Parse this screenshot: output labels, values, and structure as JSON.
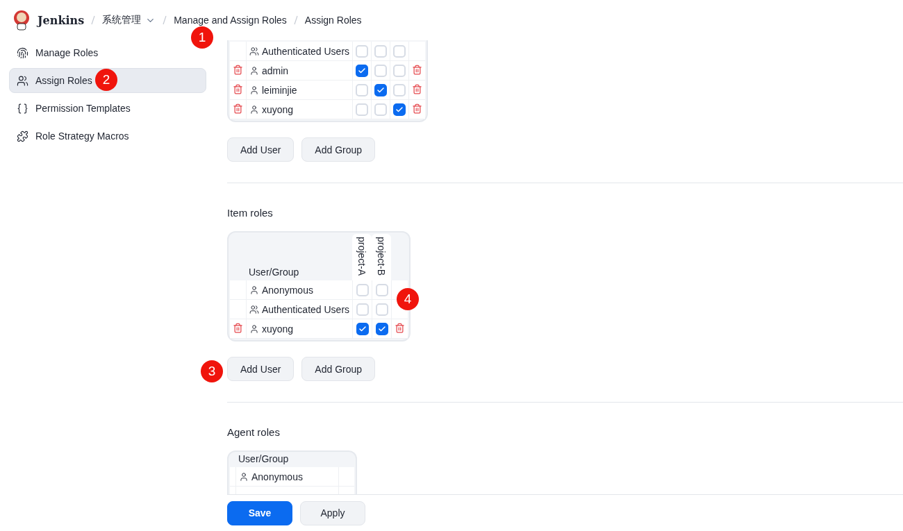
{
  "header": {
    "brand": "Jenkins",
    "breadcrumbs": [
      {
        "label": "系统管理",
        "dropdown": true
      },
      {
        "label": "Manage and Assign Roles",
        "dropdown": false
      },
      {
        "label": "Assign Roles",
        "dropdown": false
      }
    ]
  },
  "sidebar": {
    "items": [
      {
        "label": "Manage Roles",
        "selected": false
      },
      {
        "label": "Assign Roles",
        "selected": true
      },
      {
        "label": "Permission Templates",
        "selected": false
      },
      {
        "label": "Role Strategy Macros",
        "selected": false
      }
    ]
  },
  "sections": [
    {
      "rows": [
        {
          "name": "Authenticated Users",
          "kind": "group",
          "deletable": false,
          "checks": [
            false,
            false,
            false
          ]
        },
        {
          "name": "admin",
          "kind": "user",
          "deletable": true,
          "checks": [
            true,
            false,
            false
          ]
        },
        {
          "name": "leiminjie",
          "kind": "user",
          "deletable": true,
          "checks": [
            false,
            true,
            false
          ]
        },
        {
          "name": "xuyong",
          "kind": "user",
          "deletable": true,
          "checks": [
            false,
            false,
            true
          ]
        }
      ],
      "buttons": [
        "Add User",
        "Add Group"
      ]
    },
    {
      "title": "Item roles",
      "column_header": "User/Group",
      "roles": [
        "project-A",
        "project-B"
      ],
      "rows": [
        {
          "name": "Anonymous",
          "kind": "user",
          "deletable": false,
          "checks": [
            false,
            false
          ]
        },
        {
          "name": "Authenticated Users",
          "kind": "group",
          "deletable": false,
          "checks": [
            false,
            false
          ]
        },
        {
          "name": "xuyong",
          "kind": "user",
          "deletable": true,
          "checks": [
            true,
            true
          ]
        }
      ],
      "buttons": [
        "Add User",
        "Add Group"
      ]
    },
    {
      "title": "Agent roles",
      "column_header": "User/Group",
      "rows": [
        {
          "name": "Anonymous",
          "kind": "user",
          "deletable": false,
          "checks": []
        }
      ]
    }
  ],
  "footer": {
    "buttons": [
      {
        "label": "Save",
        "kind": "primary"
      },
      {
        "label": "Apply",
        "kind": "secondary"
      }
    ]
  },
  "annotations": [
    "1",
    "2",
    "3",
    "4"
  ]
}
